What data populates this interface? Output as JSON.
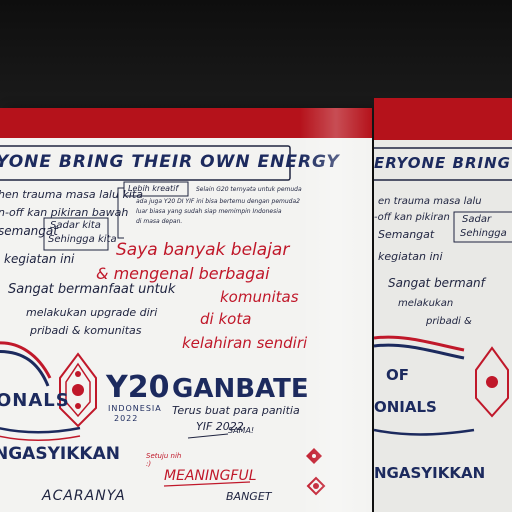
{
  "main_board": {
    "banner": "YONE BRING THEIR OWN ENERGY",
    "notes": {
      "trauma": "hen trauma masa lalu kita",
      "offkan": "n-off kan pikiran bawah",
      "semangat": "semangat",
      "sadar": "Sadar kita",
      "sehingga": "Sehingga kita",
      "lebih_kreatif": "Lebih kreatif",
      "g20_line1": "Selain G20 ternyata untuk pemuda",
      "g20_line2": "ada juga Y20 DI YIF ini bisa bertemu dengan pemuda2",
      "g20_line3": "luar biasa yang sudah siap memimpin Indonesia",
      "g20_line4": "di masa depan.",
      "kegiatan": "kegiatan ini",
      "saya_banyak": "Saya banyak belajar",
      "mengenal": "& mengenal berbagai",
      "komunitas": "komunitas",
      "di_kota": "di kota",
      "kelahiran": "kelahiran sendiri",
      "bermanfaat": "Sangat bermanfaat untuk",
      "melakukan": "melakukan upgrade diri",
      "pribadi": "pribadi & komunitas",
      "onals": "ONALS",
      "gasyikkan": "NGASYIKKAN",
      "acaranya": "ACARANYA",
      "meaningful": "MEANINGFUL",
      "banget": "BANGET",
      "setuju": "Setuju nih :)",
      "sama": "SAMA!"
    },
    "logo": {
      "y20": "Y20",
      "indonesia": "INDONESIA",
      "year": "2022"
    },
    "gambate": "GANBATE",
    "terus_semangat": "Terus buat para panitia",
    "yif": "YIF 2022"
  },
  "side_board": {
    "banner": "ERYONE BRING",
    "trauma": "en trauma masa lalu",
    "offkan": "-off kan pikiran",
    "semangat": "Semangat",
    "sadar": "Sadar",
    "sehingga": "Sehingga",
    "kegiatan": "kegiatan ini",
    "bermanfaat": "Sangat bermanf",
    "melakukan": "melakukan",
    "pribadi": "pribadi &",
    "of": "OF",
    "onials": "ONIALS",
    "gasyikkan": "NGASYIKKAN"
  },
  "colors": {
    "red": "#c0182a",
    "navy": "#1c2a5e",
    "ink": "#1f2440",
    "board": "#f3f3f1"
  }
}
